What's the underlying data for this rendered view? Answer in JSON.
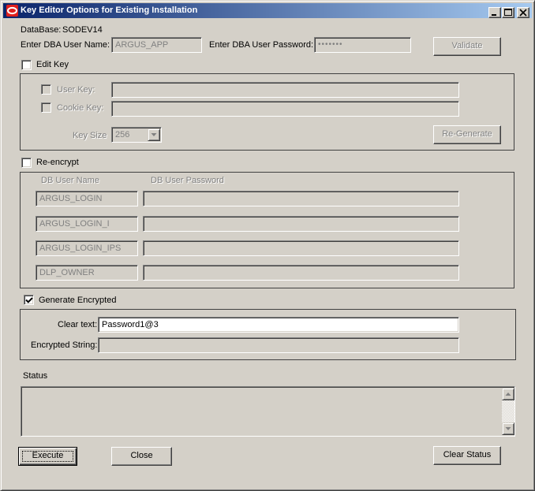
{
  "window": {
    "title": "Key Editor Options for Existing Installation",
    "minimize_icon": "minimize-icon",
    "maximize_icon": "maximize-icon",
    "close_icon": "close-icon"
  },
  "header": {
    "database_label": "DataBase:",
    "database_value": "SODEV14",
    "dba_user_label": "Enter DBA User Name:",
    "dba_user_value": "ARGUS_APP",
    "dba_password_label": "Enter DBA User Password:",
    "dba_password_value": "•••••••",
    "validate_label": "Validate"
  },
  "edit_key": {
    "checkbox_label": "Edit Key",
    "checked": false,
    "user_key_label": "User Key:",
    "user_key_value": "",
    "cookie_key_label": "Cookie Key:",
    "cookie_key_value": "",
    "key_size_label": "Key Size",
    "key_size_value": "256",
    "regenerate_label": "Re-Generate"
  },
  "re_encrypt": {
    "checkbox_label": "Re-encrypt",
    "checked": false,
    "col_user": "DB User Name",
    "col_password": "DB User Password",
    "rows": [
      {
        "user": "ARGUS_LOGIN",
        "password": ""
      },
      {
        "user": "ARGUS_LOGIN_I",
        "password": ""
      },
      {
        "user": "ARGUS_LOGIN_IPS",
        "password": ""
      },
      {
        "user": "DLP_OWNER",
        "password": ""
      }
    ]
  },
  "generate": {
    "checkbox_label": "Generate Encrypted",
    "checked": true,
    "clear_text_label": "Clear text:",
    "clear_text_value": "Password1@3",
    "encrypted_label": "Encrypted String:",
    "encrypted_value": ""
  },
  "status": {
    "label": "Status",
    "text": ""
  },
  "footer": {
    "execute_label": "Execute",
    "close_label": "Close",
    "clear_status_label": "Clear Status"
  },
  "colors": {
    "title_gradient_start": "#0a246a",
    "title_gradient_end": "#a6caf0",
    "face": "#d4d0c8",
    "disabled_text": "#808080",
    "app_icon_red": "#e0201e"
  }
}
